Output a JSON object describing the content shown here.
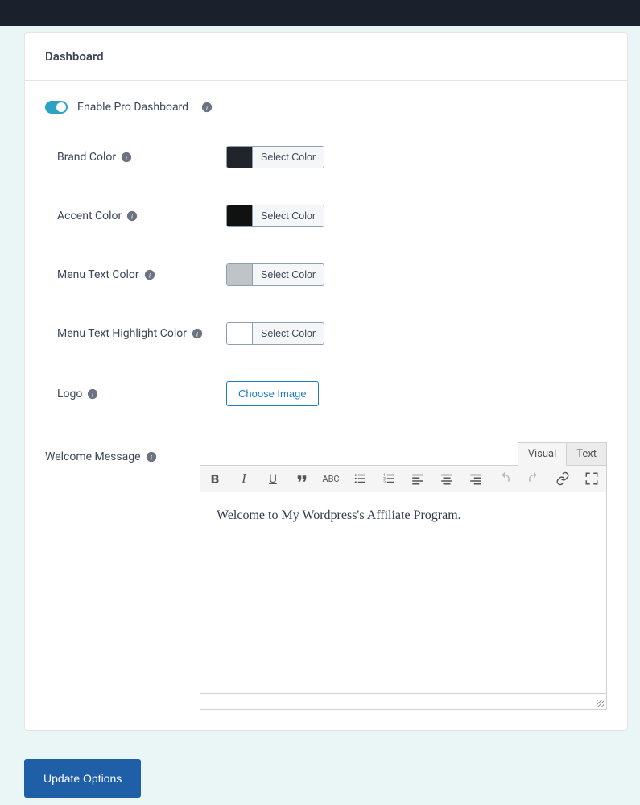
{
  "panel": {
    "title": "Dashboard"
  },
  "toggle": {
    "label": "Enable Pro Dashboard",
    "enabled": true
  },
  "fields": {
    "brand_color": {
      "label": "Brand Color",
      "button": "Select Color",
      "swatch": "swatch-dark"
    },
    "accent_color": {
      "label": "Accent Color",
      "button": "Select Color",
      "swatch": "swatch-black"
    },
    "menu_text_color": {
      "label": "Menu Text Color",
      "button": "Select Color",
      "swatch": "swatch-gray"
    },
    "menu_text_highlight_color": {
      "label": "Menu Text Highlight Color",
      "button": "Select Color",
      "swatch": "swatch-white"
    },
    "logo": {
      "label": "Logo",
      "button": "Choose Image"
    }
  },
  "welcome": {
    "label": "Welcome Message",
    "tabs": {
      "visual": "Visual",
      "text": "Text",
      "active": "visual"
    },
    "content": "Welcome to My Wordpress's Affiliate Program."
  },
  "actions": {
    "update": "Update Options"
  }
}
